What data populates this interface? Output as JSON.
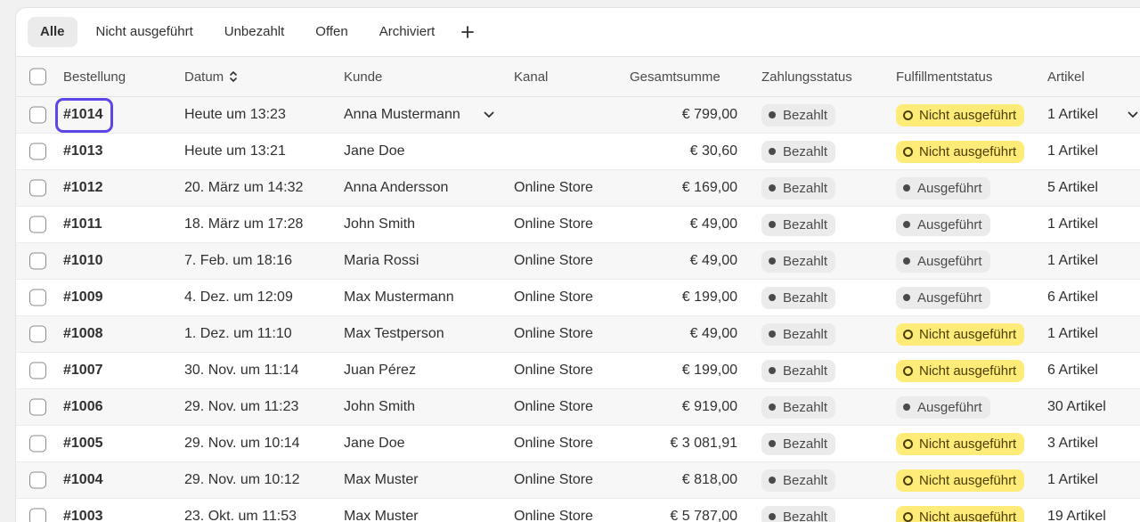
{
  "tabs": [
    {
      "label": "Alle",
      "active": true
    },
    {
      "label": "Nicht ausgeführt",
      "active": false
    },
    {
      "label": "Unbezahlt",
      "active": false
    },
    {
      "label": "Offen",
      "active": false
    },
    {
      "label": "Archiviert",
      "active": false
    }
  ],
  "add_tab_icon": "plus-icon",
  "columns": {
    "order": "Bestellung",
    "date": "Datum",
    "customer": "Kunde",
    "channel": "Kanal",
    "total": "Gesamtsumme",
    "payment": "Zahlungsstatus",
    "fulfillment": "Fulfillmentstatus",
    "items": "Artikel"
  },
  "colors": {
    "focus_ring": "#5b46e8",
    "badge_unfulfilled": "#ffeb78",
    "badge_neutral": "#ebebeb"
  },
  "orders": [
    {
      "id": "#1014",
      "date": "Heute um 13:23",
      "customer": "Anna Mustermann",
      "channel": "",
      "total": "€ 799,00",
      "payment": "Bezahlt",
      "fulfillment": "Nicht ausgeführt",
      "unfulfilled": true,
      "items": "1 Artikel",
      "focused": true
    },
    {
      "id": "#1013",
      "date": "Heute um 13:21",
      "customer": "Jane Doe",
      "channel": "",
      "total": "€ 30,60",
      "payment": "Bezahlt",
      "fulfillment": "Nicht ausgeführt",
      "unfulfilled": true,
      "items": "1 Artikel"
    },
    {
      "id": "#1012",
      "date": "20. März um 14:32",
      "customer": "Anna Andersson",
      "channel": "Online Store",
      "total": "€ 169,00",
      "payment": "Bezahlt",
      "fulfillment": "Ausgeführt",
      "unfulfilled": false,
      "items": "5 Artikel"
    },
    {
      "id": "#1011",
      "date": "18. März um 17:28",
      "customer": "John Smith",
      "channel": "Online Store",
      "total": "€ 49,00",
      "payment": "Bezahlt",
      "fulfillment": "Ausgeführt",
      "unfulfilled": false,
      "items": "1 Artikel"
    },
    {
      "id": "#1010",
      "date": "7. Feb. um 18:16",
      "customer": "Maria Rossi",
      "channel": "Online Store",
      "total": "€ 49,00",
      "payment": "Bezahlt",
      "fulfillment": "Ausgeführt",
      "unfulfilled": false,
      "items": "1 Artikel"
    },
    {
      "id": "#1009",
      "date": "4. Dez. um 12:09",
      "customer": "Max Mustermann",
      "channel": "Online Store",
      "total": "€ 199,00",
      "payment": "Bezahlt",
      "fulfillment": "Ausgeführt",
      "unfulfilled": false,
      "items": "6 Artikel"
    },
    {
      "id": "#1008",
      "date": "1. Dez. um 11:10",
      "customer": "Max Testperson",
      "channel": "Online Store",
      "total": "€ 49,00",
      "payment": "Bezahlt",
      "fulfillment": "Nicht ausgeführt",
      "unfulfilled": true,
      "items": "1 Artikel"
    },
    {
      "id": "#1007",
      "date": "30. Nov. um 11:14",
      "customer": "Juan Pérez",
      "channel": "Online Store",
      "total": "€ 199,00",
      "payment": "Bezahlt",
      "fulfillment": "Nicht ausgeführt",
      "unfulfilled": true,
      "items": "6 Artikel"
    },
    {
      "id": "#1006",
      "date": "29. Nov. um 11:23",
      "customer": "John Smith",
      "channel": "Online Store",
      "total": "€ 919,00",
      "payment": "Bezahlt",
      "fulfillment": "Ausgeführt",
      "unfulfilled": false,
      "items": "30 Artikel"
    },
    {
      "id": "#1005",
      "date": "29. Nov. um 10:14",
      "customer": "Jane Doe",
      "channel": "Online Store",
      "total": "€ 3 081,91",
      "payment": "Bezahlt",
      "fulfillment": "Nicht ausgeführt",
      "unfulfilled": true,
      "items": "3 Artikel"
    },
    {
      "id": "#1004",
      "date": "29. Nov. um 10:12",
      "customer": "Max Muster",
      "channel": "Online Store",
      "total": "€ 818,00",
      "payment": "Bezahlt",
      "fulfillment": "Nicht ausgeführt",
      "unfulfilled": true,
      "items": "1 Artikel"
    },
    {
      "id": "#1003",
      "date": "23. Okt. um 11:53",
      "customer": "Max Muster",
      "channel": "Online Store",
      "total": "€ 5 787,00",
      "payment": "Bezahlt",
      "fulfillment": "Nicht ausgeführt",
      "unfulfilled": true,
      "items": "19 Artikel"
    }
  ]
}
